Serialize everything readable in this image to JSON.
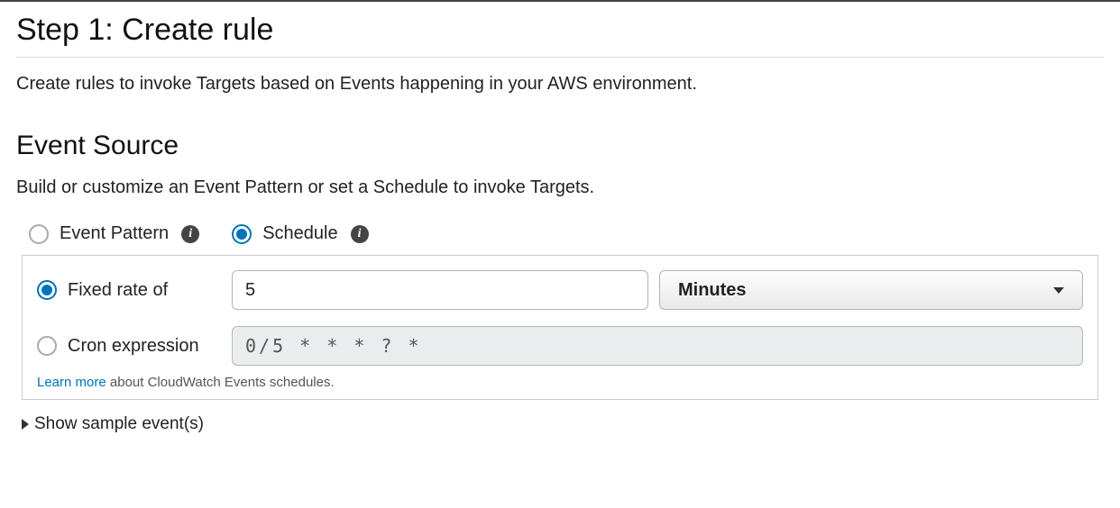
{
  "header": {
    "title": "Step 1: Create rule",
    "description": "Create rules to invoke Targets based on Events happening in your AWS environment."
  },
  "eventSource": {
    "heading": "Event Source",
    "description": "Build or customize an Event Pattern or set a Schedule to invoke Targets.",
    "options": {
      "eventPattern": {
        "label": "Event Pattern",
        "selected": false
      },
      "schedule": {
        "label": "Schedule",
        "selected": true
      }
    },
    "schedule": {
      "fixedRate": {
        "label": "Fixed rate of",
        "selected": true,
        "value": "5",
        "unit": "Minutes"
      },
      "cron": {
        "label": "Cron expression",
        "selected": false,
        "value": "0/5 * * * ? *"
      },
      "learnMore": {
        "link": "Learn more",
        "text": " about CloudWatch Events schedules."
      }
    },
    "sampleToggle": "Show sample event(s)"
  }
}
